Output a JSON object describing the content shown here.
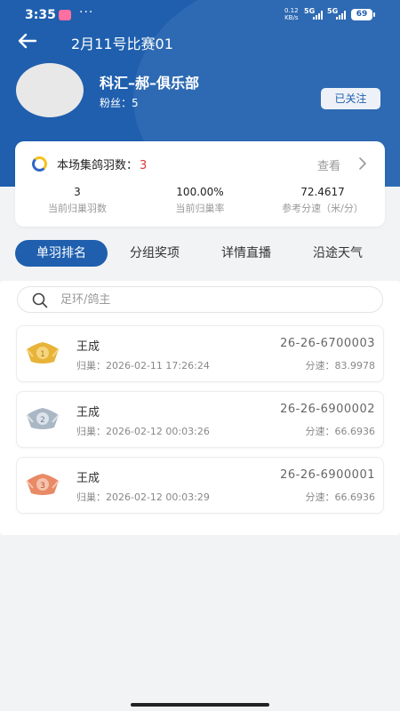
{
  "status_bar": {
    "time": "3:35",
    "dots": "···",
    "net_speed_value": "0.12",
    "net_speed_unit": "KB/s",
    "signal_label_1": "5G",
    "signal_label_2": "5G",
    "battery": "69"
  },
  "nav": {
    "title": "2月11号比赛01"
  },
  "profile": {
    "club_name": "科汇–郝–俱乐部",
    "fans": "粉丝：5",
    "follow_label": "已关注"
  },
  "race_stats": {
    "count_label": "本场集鸽羽数：",
    "count_value": "3",
    "view_label": "查看",
    "items": [
      {
        "value": "3",
        "label": "当前归巢羽数"
      },
      {
        "value": "100.00%",
        "label": "当前归巢率"
      },
      {
        "value": "72.4617",
        "label": "参考分速（米/分）"
      }
    ]
  },
  "tabs": [
    {
      "label": "单羽排名",
      "active": true
    },
    {
      "label": "分组奖项",
      "active": false
    },
    {
      "label": "详情直播",
      "active": false
    },
    {
      "label": "沿途天气",
      "active": false
    }
  ],
  "search": {
    "placeholder": "足环/鸽主"
  },
  "rankings": [
    {
      "rank": "1",
      "name": "王成",
      "arrival": "归巢：2026-02-11 17:26:24",
      "ring_no": "26-26-6700003",
      "speed": "分速：83.9978",
      "medal_color": "#e8b339"
    },
    {
      "rank": "2",
      "name": "王成",
      "arrival": "归巢：2026-02-12 00:03:26",
      "ring_no": "26-26-6900002",
      "speed": "分速：66.6936",
      "medal_color": "#aab7c4"
    },
    {
      "rank": "3",
      "name": "王成",
      "arrival": "归巢：2026-02-12 00:03:29",
      "ring_no": "26-26-6900001",
      "speed": "分速：66.6936",
      "medal_color": "#e88a66"
    }
  ],
  "colors": {
    "brand": "#1f5fae",
    "count_highlight": "#e03636"
  }
}
